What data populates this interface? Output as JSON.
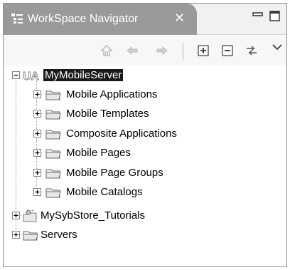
{
  "view": {
    "title": "WorkSpace Navigator",
    "close_glyph": "✕",
    "tab_icon": "navigator-icon",
    "minimize_icon": "minimize-icon",
    "maximize_icon": "maximize-icon"
  },
  "toolbar": {
    "buttons": [
      "home-icon",
      "back-arrow-icon",
      "forward-arrow-icon",
      "expand-all-icon",
      "collapse-all-icon",
      "link-with-editor-icon",
      "view-menu-icon"
    ]
  },
  "tree": {
    "root": {
      "label": "MyMobileServer",
      "badge": "UA",
      "expanded": true,
      "selected": true
    },
    "children": [
      {
        "label": "Mobile Applications"
      },
      {
        "label": "Mobile Templates"
      },
      {
        "label": "Composite Applications"
      },
      {
        "label": "Mobile Pages"
      },
      {
        "label": "Mobile Page Groups"
      },
      {
        "label": "Mobile Catalogs"
      }
    ],
    "siblings": [
      {
        "label": "MySybStore_Tutorials",
        "icon": "project-icon"
      },
      {
        "label": "Servers",
        "icon": "folder-icon"
      }
    ]
  }
}
